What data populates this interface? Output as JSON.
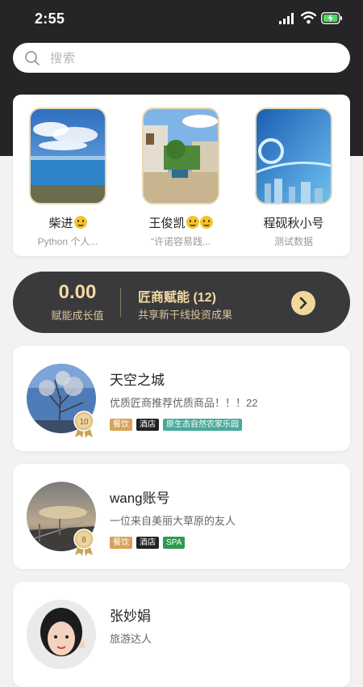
{
  "status_bar": {
    "time": "2:55"
  },
  "search": {
    "placeholder": "搜索"
  },
  "featured": [
    {
      "name": "柴进",
      "subtitle": "Python 个人..."
    },
    {
      "name": "王俊凯",
      "subtitle": "“许诺容易践..."
    },
    {
      "name": "程砚秋小号",
      "subtitle": "测试数据"
    }
  ],
  "growth": {
    "value": "0.00",
    "value_label": "赋能成长值",
    "title": "匠商赋能 (12)",
    "subtitle": "共享新干线投资成果"
  },
  "users": [
    {
      "name": "天空之城",
      "desc": "优质匠商推荐优质商品！！！22",
      "level": "10",
      "tags": [
        {
          "label": "餐饮",
          "type": "food"
        },
        {
          "label": "酒店",
          "type": "hotel"
        },
        {
          "label": "原生态自然农家乐园",
          "type": "eco"
        }
      ]
    },
    {
      "name": "wang账号",
      "desc": "一位来自美丽大草原的友人",
      "level": "8",
      "tags": [
        {
          "label": "餐饮",
          "type": "food"
        },
        {
          "label": "酒店",
          "type": "hotel"
        },
        {
          "label": "SPA",
          "type": "spa"
        }
      ]
    },
    {
      "name": "张妙娟",
      "desc": "旅游达人",
      "level": "",
      "tags": []
    }
  ],
  "colors": {
    "header_bg": "#252527",
    "gold": "#f3d9a4",
    "banner_bg": "#3a3a3c"
  }
}
